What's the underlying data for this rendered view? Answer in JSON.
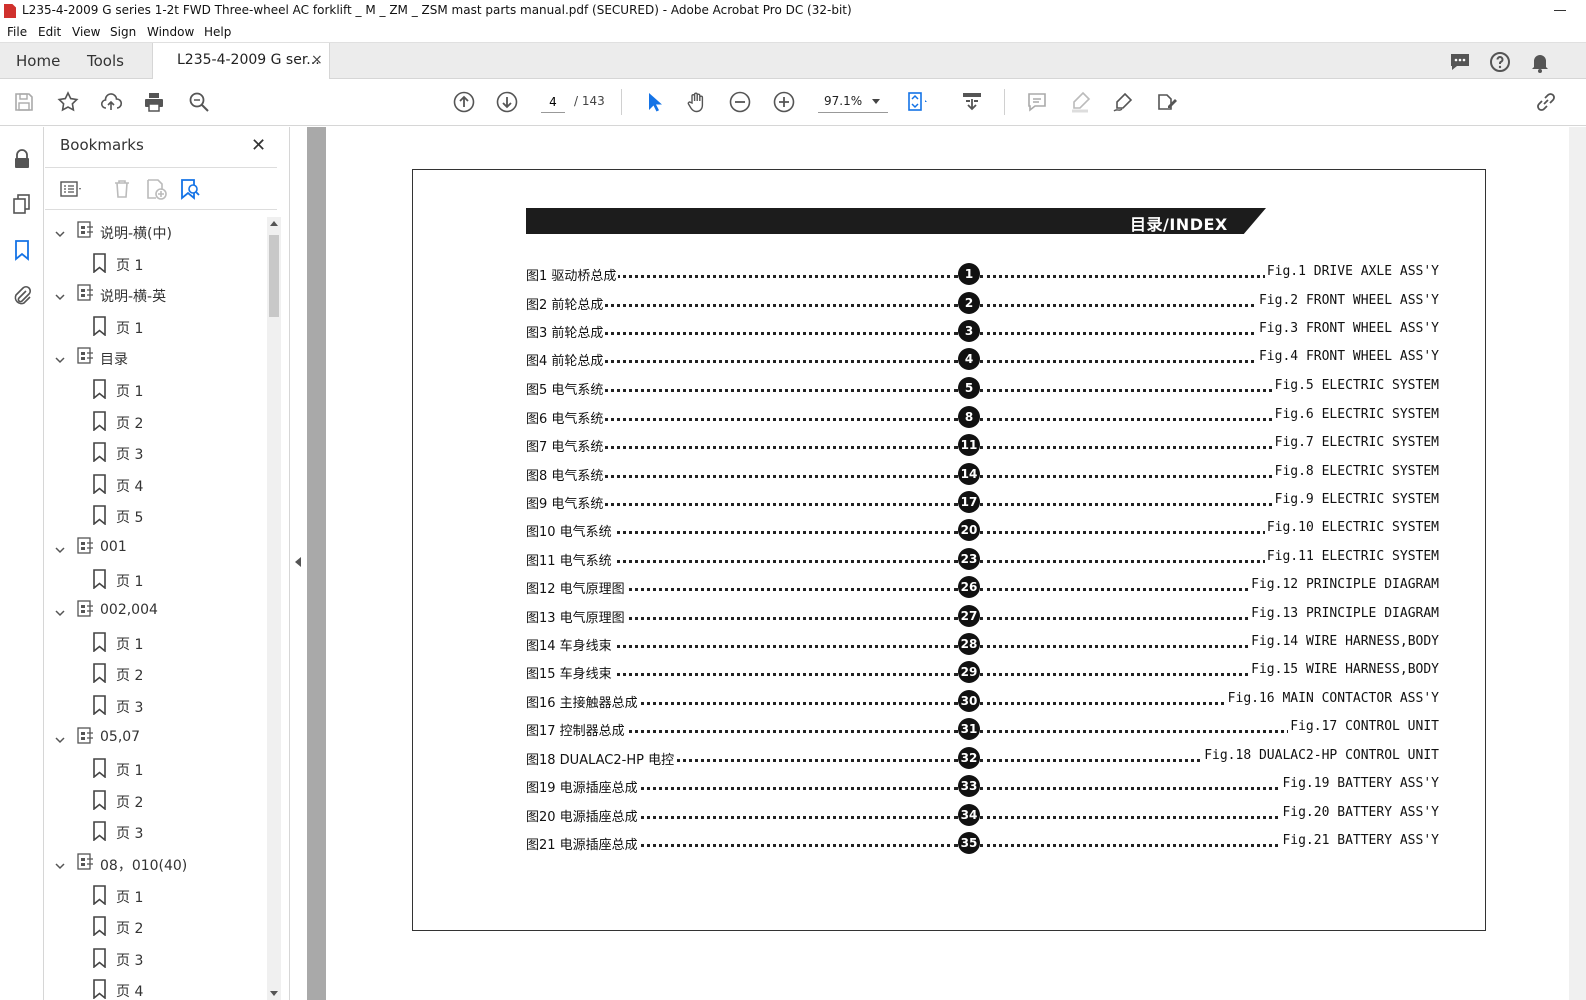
{
  "window": {
    "title": "L235-4-2009 G series 1-2t FWD Three-wheel AC forklift _ M _ ZM _ ZSM mast parts manual.pdf (SECURED) - Adobe Acrobat Pro DC (32-bit)"
  },
  "menu": [
    "File",
    "Edit",
    "View",
    "Sign",
    "Window",
    "Help"
  ],
  "tabs": {
    "home": "Home",
    "tools": "Tools",
    "document": "L235-4-2009 G ser...",
    "close": "×"
  },
  "toolbar": {
    "page_current": "4",
    "page_total": "/ 143",
    "zoom": "97.1%"
  },
  "bookmarks_panel": {
    "title": "Bookmarks",
    "close": "✕",
    "items": [
      {
        "label": "说明-横(中)",
        "level": 0
      },
      {
        "label": "页 1",
        "level": 1
      },
      {
        "label": "说明-横-英",
        "level": 0
      },
      {
        "label": "页 1",
        "level": 1
      },
      {
        "label": "目录",
        "level": 0
      },
      {
        "label": "页 1",
        "level": 1
      },
      {
        "label": "页 2",
        "level": 1
      },
      {
        "label": "页 3",
        "level": 1
      },
      {
        "label": "页 4",
        "level": 1
      },
      {
        "label": "页 5",
        "level": 1
      },
      {
        "label": "001",
        "level": 0
      },
      {
        "label": "页 1",
        "level": 1
      },
      {
        "label": "002,004",
        "level": 0
      },
      {
        "label": "页 1",
        "level": 1
      },
      {
        "label": "页 2",
        "level": 1
      },
      {
        "label": "页 3",
        "level": 1
      },
      {
        "label": "05,07",
        "level": 0
      },
      {
        "label": "页 1",
        "level": 1
      },
      {
        "label": "页 2",
        "level": 1
      },
      {
        "label": "页 3",
        "level": 1
      },
      {
        "label": "08，010(40)",
        "level": 0
      },
      {
        "label": "页 1",
        "level": 1
      },
      {
        "label": "页 2",
        "level": 1
      },
      {
        "label": "页 3",
        "level": 1
      },
      {
        "label": "页 4",
        "level": 1
      }
    ]
  },
  "page": {
    "banner": "目录/INDEX",
    "entries": [
      {
        "cn": "图1  驱动桥总成",
        "num": "1",
        "en": "Fig.1 DRIVE AXLE ASS'Y"
      },
      {
        "cn": "图2  前轮总成",
        "num": "2",
        "en": "Fig.2 FRONT WHEEL ASS'Y"
      },
      {
        "cn": "图3  前轮总成",
        "num": "3",
        "en": "Fig.3 FRONT WHEEL ASS'Y"
      },
      {
        "cn": "图4  前轮总成",
        "num": "4",
        "en": "Fig.4 FRONT WHEEL ASS'Y"
      },
      {
        "cn": "图5  电气系统",
        "num": "5",
        "en": "Fig.5 ELECTRIC SYSTEM"
      },
      {
        "cn": "图6  电气系统",
        "num": "8",
        "en": "Fig.6 ELECTRIC SYSTEM"
      },
      {
        "cn": "图7  电气系统",
        "num": "11",
        "en": "Fig.7 ELECTRIC SYSTEM"
      },
      {
        "cn": "图8  电气系统",
        "num": "14",
        "en": "Fig.8 ELECTRIC SYSTEM"
      },
      {
        "cn": "图9  电气系统",
        "num": "17",
        "en": "Fig.9 ELECTRIC SYSTEM"
      },
      {
        "cn": "图10  电气系统",
        "num": "20",
        "en": "Fig.10 ELECTRIC SYSTEM"
      },
      {
        "cn": "图11  电气系统",
        "num": "23",
        "en": "Fig.11 ELECTRIC SYSTEM"
      },
      {
        "cn": "图12  电气原理图",
        "num": "26",
        "en": "Fig.12 PRINCIPLE DIAGRAM"
      },
      {
        "cn": "图13  电气原理图",
        "num": "27",
        "en": "Fig.13 PRINCIPLE DIAGRAM"
      },
      {
        "cn": "图14  车身线束",
        "num": "28",
        "en": "Fig.14 WIRE HARNESS,BODY"
      },
      {
        "cn": "图15  车身线束",
        "num": "29",
        "en": "Fig.15 WIRE HARNESS,BODY"
      },
      {
        "cn": "图16  主接触器总成",
        "num": "30",
        "en": "Fig.16 MAIN CONTACTOR ASS'Y"
      },
      {
        "cn": "图17  控制器总成",
        "num": "31",
        "en": "Fig.17 CONTROL UNIT"
      },
      {
        "cn": "图18  DUALAC2-HP 电控",
        "num": "32",
        "en": "Fig.18 DUALAC2-HP CONTROL UNIT"
      },
      {
        "cn": "图19  电源插座总成",
        "num": "33",
        "en": "Fig.19 BATTERY ASS'Y"
      },
      {
        "cn": "图20  电源插座总成",
        "num": "34",
        "en": "Fig.20 BATTERY ASS'Y"
      },
      {
        "cn": "图21  电源插座总成",
        "num": "35",
        "en": "Fig.21 BATTERY ASS'Y"
      }
    ]
  },
  "colors": {
    "accent_blue": "#1473e6",
    "icon_gray": "#555555",
    "pdf_red": "#d0312d"
  }
}
